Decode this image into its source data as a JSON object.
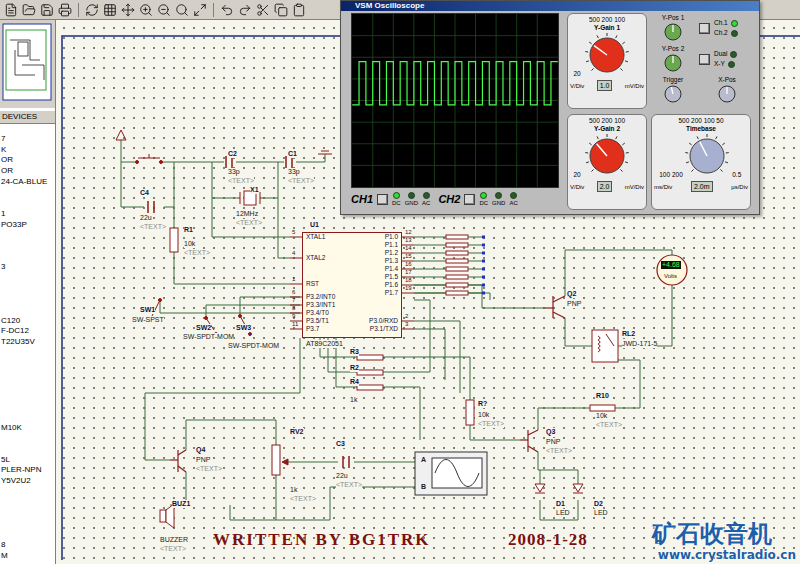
{
  "devices": {
    "header": "DEVICES",
    "items": [
      "7",
      "K",
      "OR",
      "OR",
      "24-CA-BLUE",
      "",
      "",
      "1",
      "PO33P",
      "",
      "",
      "",
      "3",
      "",
      "",
      "",
      "",
      "C120",
      "F-DC12",
      "T22U35V",
      "",
      "",
      "",
      "",
      "",
      "",
      "",
      "M10K",
      "",
      "",
      "5L",
      "PLER-NPN",
      "Y5V2U2",
      "",
      "",
      "",
      "",
      "",
      "8",
      "M"
    ]
  },
  "schematic": {
    "labels": [
      {
        "text": "C2",
        "kind": "ref"
      },
      {
        "text": "33p",
        "kind": "value"
      },
      {
        "text": "<TEXT>",
        "kind": "placeholder"
      },
      {
        "text": "C1",
        "kind": "ref"
      },
      {
        "text": "33p",
        "kind": "value"
      },
      {
        "text": "<TEXT>",
        "kind": "placeholder"
      },
      {
        "text": "X1",
        "kind": "ref"
      },
      {
        "text": "12MHz",
        "kind": "value"
      },
      {
        "text": "<TEXT>",
        "kind": "placeholder"
      },
      {
        "text": "C4",
        "kind": "ref"
      },
      {
        "text": "22u",
        "kind": "value"
      },
      {
        "text": "<TEXT>",
        "kind": "placeholder"
      },
      {
        "text": "R1",
        "kind": "ref"
      },
      {
        "text": "10k",
        "kind": "value"
      },
      {
        "text": "<TEXT>",
        "kind": "placeholder"
      },
      {
        "text": "U1",
        "kind": "ref"
      },
      {
        "text": "SW1",
        "kind": "ref"
      },
      {
        "text": "SW-SPST",
        "kind": "value"
      },
      {
        "text": "SW2",
        "kind": "ref"
      },
      {
        "text": "SW-SPDT-MOM",
        "kind": "value"
      },
      {
        "text": "SW3",
        "kind": "ref"
      },
      {
        "text": "SW-SPDT-MOM",
        "kind": "value"
      },
      {
        "text": "R3",
        "kind": "ref"
      },
      {
        "text": "R2",
        "kind": "ref"
      },
      {
        "text": "R4",
        "kind": "ref"
      },
      {
        "text": "1k",
        "kind": "value"
      },
      {
        "text": "Q2",
        "kind": "ref"
      },
      {
        "text": "PNP",
        "kind": "value"
      },
      {
        "text": "RL2",
        "kind": "ref"
      },
      {
        "text": "JWD-171-5",
        "kind": "value"
      },
      {
        "text": "R?",
        "kind": "ref"
      },
      {
        "text": "10k",
        "kind": "value"
      },
      {
        "text": "<TEXT>",
        "kind": "placeholder"
      },
      {
        "text": "R10",
        "kind": "ref"
      },
      {
        "text": "10k",
        "kind": "value"
      },
      {
        "text": "<TEXT>",
        "kind": "placeholder"
      },
      {
        "text": "Q3",
        "kind": "ref"
      },
      {
        "text": "PNP",
        "kind": "value"
      },
      {
        "text": "<TEXT>",
        "kind": "placeholder"
      },
      {
        "text": "D1",
        "kind": "ref"
      },
      {
        "text": "LED",
        "kind": "value"
      },
      {
        "text": "D2",
        "kind": "ref"
      },
      {
        "text": "LED",
        "kind": "value"
      },
      {
        "text": "Q4",
        "kind": "ref"
      },
      {
        "text": "PNP",
        "kind": "value"
      },
      {
        "text": "<TEXT>",
        "kind": "placeholder"
      },
      {
        "text": "RV2",
        "kind": "ref"
      },
      {
        "text": "1k",
        "kind": "value"
      },
      {
        "text": "<TEXT>",
        "kind": "placeholder"
      },
      {
        "text": "C3",
        "kind": "ref"
      },
      {
        "text": "22u",
        "kind": "value"
      },
      {
        "text": "<TEXT>",
        "kind": "placeholder"
      },
      {
        "text": "BUZ1",
        "kind": "ref"
      },
      {
        "text": "BUZZER",
        "kind": "value"
      },
      {
        "text": "<TEXT>",
        "kind": "placeholder"
      }
    ],
    "chip": {
      "name": "AT89C2051",
      "left_pins": [
        {
          "num": "5",
          "name": "XTAL1"
        },
        {
          "num": "4",
          "name": "XTAL2"
        },
        {
          "num": "1",
          "name": "RST"
        },
        {
          "num": "6",
          "name": "P3.2/INT0"
        },
        {
          "num": "7",
          "name": "P3.3/INT1"
        },
        {
          "num": "8",
          "name": "P3.4/T0"
        },
        {
          "num": "9",
          "name": "P3.5/T1"
        },
        {
          "num": "11",
          "name": "P3.7"
        }
      ],
      "right_pins": [
        {
          "num": "12",
          "name": "P1.0"
        },
        {
          "num": "13",
          "name": "P1.1"
        },
        {
          "num": "14",
          "name": "P1.2"
        },
        {
          "num": "15",
          "name": "P1.3"
        },
        {
          "num": "16",
          "name": "P1.4"
        },
        {
          "num": "17",
          "name": "P1.5"
        },
        {
          "num": "18",
          "name": "P1.6"
        },
        {
          "num": "19",
          "name": "P1.7"
        },
        {
          "num": "2",
          "name": "P3.0/RXD"
        },
        {
          "num": "3",
          "name": "P3.1/TXD"
        }
      ]
    },
    "voltmeter": {
      "reading": "+4.68",
      "unit": "Volts"
    },
    "scope_inputs": [
      "A",
      "B"
    ],
    "credit": "WRITTEN BY BG1TRK",
    "date": "2008-1-28"
  },
  "watermark": {
    "title": "矿石收音机",
    "url": "www.crystalradio.cn"
  },
  "oscilloscope": {
    "title": "VSM Oscilloscope",
    "trace": {
      "channel": "CH1",
      "volts": [
        -0.2,
        1.8,
        -0.2,
        1.8,
        -0.2,
        1.8,
        -0.2,
        1.8,
        -0.2,
        1.8,
        -0.2,
        1.8,
        -0.2,
        1.8,
        -0.2,
        1.8,
        -0.2,
        1.8,
        -0.2,
        1.8,
        -0.2,
        1.8,
        -0.2,
        1.8,
        -0.2,
        1.8,
        -0.2,
        1.8,
        -0.2,
        1.8
      ]
    },
    "inputs": [
      {
        "label": "CH1",
        "modes": [
          {
            "label": "DC",
            "selected": true
          },
          {
            "label": "GND",
            "selected": false
          },
          {
            "label": "AC",
            "selected": false
          }
        ]
      },
      {
        "label": "CH2",
        "modes": [
          {
            "label": "DC",
            "selected": true
          },
          {
            "label": "GND",
            "selected": false
          },
          {
            "label": "AC",
            "selected": false
          }
        ]
      }
    ],
    "gains": [
      {
        "title": "Y-Gain 1",
        "ticks": [
          "500 200 100",
          "20"
        ],
        "readout": "1.0",
        "units": [
          "V/Div",
          "mV/Div"
        ],
        "level": 0.3
      },
      {
        "title": "Y-Gain 2",
        "ticks": [
          "500 200 100",
          "20"
        ],
        "readout": "2.0",
        "units": [
          "V/Div",
          "mV/Div"
        ],
        "level": 0.35
      }
    ],
    "controls": [
      {
        "label": "Y-Pos 1",
        "kind": "position",
        "level": 0.5
      },
      {
        "label": "Y-Pos 2",
        "kind": "position",
        "level": 0.5
      },
      {
        "label": "Trigger",
        "kind": "trigger",
        "level": 0.45
      },
      {
        "label": "X-Pos",
        "kind": "trigger",
        "level": 0.5
      }
    ],
    "switches": [
      {
        "items": [
          {
            "label": "Ch.1",
            "on": true
          },
          {
            "label": "Ch.2",
            "on": false
          }
        ]
      },
      {
        "items": [
          {
            "label": "Dual",
            "on": false
          },
          {
            "label": "X-Y",
            "on": false
          }
        ]
      }
    ],
    "timebase": {
      "title": "Timebase",
      "ticks": [
        "500 200 100 50",
        "100 200",
        "0.5"
      ],
      "readout": "2.0m",
      "units": [
        "ms/Div",
        "µs/Div"
      ],
      "level": 0.4
    }
  }
}
